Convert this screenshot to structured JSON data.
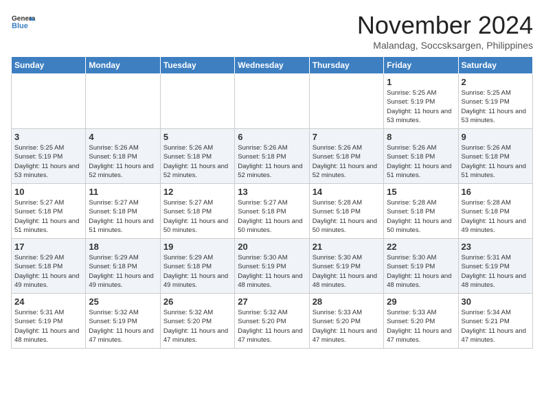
{
  "header": {
    "logo_line1": "General",
    "logo_line2": "Blue",
    "month": "November 2024",
    "location": "Malandag, Soccsksargen, Philippines"
  },
  "days_of_week": [
    "Sunday",
    "Monday",
    "Tuesday",
    "Wednesday",
    "Thursday",
    "Friday",
    "Saturday"
  ],
  "weeks": [
    [
      {
        "day": "",
        "info": ""
      },
      {
        "day": "",
        "info": ""
      },
      {
        "day": "",
        "info": ""
      },
      {
        "day": "",
        "info": ""
      },
      {
        "day": "",
        "info": ""
      },
      {
        "day": "1",
        "info": "Sunrise: 5:25 AM\nSunset: 5:19 PM\nDaylight: 11 hours\nand 53 minutes."
      },
      {
        "day": "2",
        "info": "Sunrise: 5:25 AM\nSunset: 5:19 PM\nDaylight: 11 hours\nand 53 minutes."
      }
    ],
    [
      {
        "day": "3",
        "info": "Sunrise: 5:25 AM\nSunset: 5:19 PM\nDaylight: 11 hours\nand 53 minutes."
      },
      {
        "day": "4",
        "info": "Sunrise: 5:26 AM\nSunset: 5:18 PM\nDaylight: 11 hours\nand 52 minutes."
      },
      {
        "day": "5",
        "info": "Sunrise: 5:26 AM\nSunset: 5:18 PM\nDaylight: 11 hours\nand 52 minutes."
      },
      {
        "day": "6",
        "info": "Sunrise: 5:26 AM\nSunset: 5:18 PM\nDaylight: 11 hours\nand 52 minutes."
      },
      {
        "day": "7",
        "info": "Sunrise: 5:26 AM\nSunset: 5:18 PM\nDaylight: 11 hours\nand 52 minutes."
      },
      {
        "day": "8",
        "info": "Sunrise: 5:26 AM\nSunset: 5:18 PM\nDaylight: 11 hours\nand 51 minutes."
      },
      {
        "day": "9",
        "info": "Sunrise: 5:26 AM\nSunset: 5:18 PM\nDaylight: 11 hours\nand 51 minutes."
      }
    ],
    [
      {
        "day": "10",
        "info": "Sunrise: 5:27 AM\nSunset: 5:18 PM\nDaylight: 11 hours\nand 51 minutes."
      },
      {
        "day": "11",
        "info": "Sunrise: 5:27 AM\nSunset: 5:18 PM\nDaylight: 11 hours\nand 51 minutes."
      },
      {
        "day": "12",
        "info": "Sunrise: 5:27 AM\nSunset: 5:18 PM\nDaylight: 11 hours\nand 50 minutes."
      },
      {
        "day": "13",
        "info": "Sunrise: 5:27 AM\nSunset: 5:18 PM\nDaylight: 11 hours\nand 50 minutes."
      },
      {
        "day": "14",
        "info": "Sunrise: 5:28 AM\nSunset: 5:18 PM\nDaylight: 11 hours\nand 50 minutes."
      },
      {
        "day": "15",
        "info": "Sunrise: 5:28 AM\nSunset: 5:18 PM\nDaylight: 11 hours\nand 50 minutes."
      },
      {
        "day": "16",
        "info": "Sunrise: 5:28 AM\nSunset: 5:18 PM\nDaylight: 11 hours\nand 49 minutes."
      }
    ],
    [
      {
        "day": "17",
        "info": "Sunrise: 5:29 AM\nSunset: 5:18 PM\nDaylight: 11 hours\nand 49 minutes."
      },
      {
        "day": "18",
        "info": "Sunrise: 5:29 AM\nSunset: 5:18 PM\nDaylight: 11 hours\nand 49 minutes."
      },
      {
        "day": "19",
        "info": "Sunrise: 5:29 AM\nSunset: 5:18 PM\nDaylight: 11 hours\nand 49 minutes."
      },
      {
        "day": "20",
        "info": "Sunrise: 5:30 AM\nSunset: 5:19 PM\nDaylight: 11 hours\nand 48 minutes."
      },
      {
        "day": "21",
        "info": "Sunrise: 5:30 AM\nSunset: 5:19 PM\nDaylight: 11 hours\nand 48 minutes."
      },
      {
        "day": "22",
        "info": "Sunrise: 5:30 AM\nSunset: 5:19 PM\nDaylight: 11 hours\nand 48 minutes."
      },
      {
        "day": "23",
        "info": "Sunrise: 5:31 AM\nSunset: 5:19 PM\nDaylight: 11 hours\nand 48 minutes."
      }
    ],
    [
      {
        "day": "24",
        "info": "Sunrise: 5:31 AM\nSunset: 5:19 PM\nDaylight: 11 hours\nand 48 minutes."
      },
      {
        "day": "25",
        "info": "Sunrise: 5:32 AM\nSunset: 5:19 PM\nDaylight: 11 hours\nand 47 minutes."
      },
      {
        "day": "26",
        "info": "Sunrise: 5:32 AM\nSunset: 5:20 PM\nDaylight: 11 hours\nand 47 minutes."
      },
      {
        "day": "27",
        "info": "Sunrise: 5:32 AM\nSunset: 5:20 PM\nDaylight: 11 hours\nand 47 minutes."
      },
      {
        "day": "28",
        "info": "Sunrise: 5:33 AM\nSunset: 5:20 PM\nDaylight: 11 hours\nand 47 minutes."
      },
      {
        "day": "29",
        "info": "Sunrise: 5:33 AM\nSunset: 5:20 PM\nDaylight: 11 hours\nand 47 minutes."
      },
      {
        "day": "30",
        "info": "Sunrise: 5:34 AM\nSunset: 5:21 PM\nDaylight: 11 hours\nand 47 minutes."
      }
    ]
  ]
}
